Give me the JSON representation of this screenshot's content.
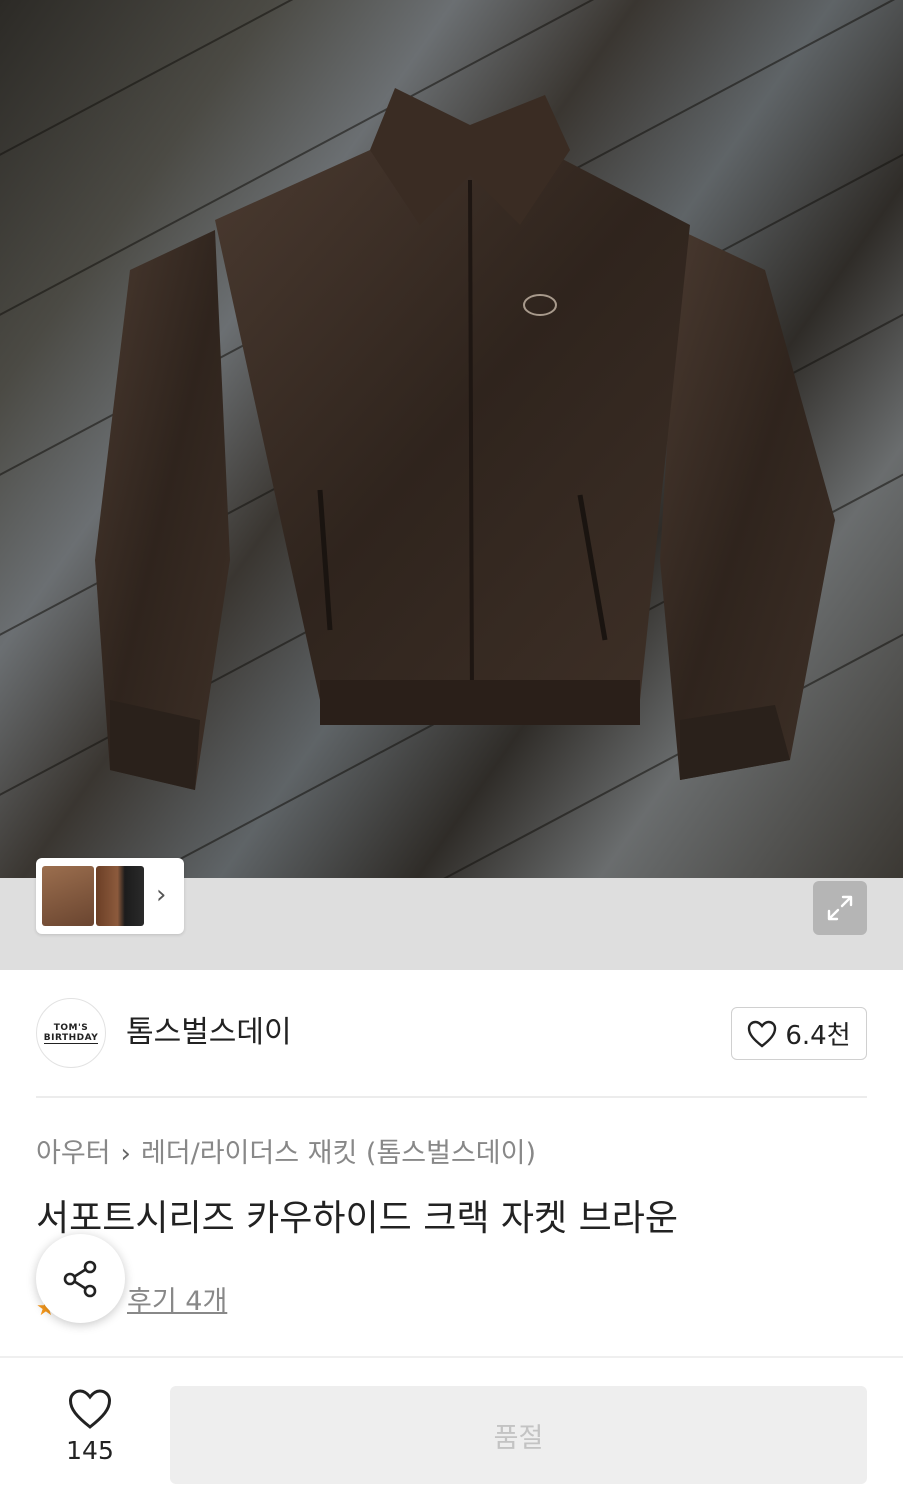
{
  "brand": {
    "logo_line1": "TOM'S",
    "logo_line2": "BIRTHDAY",
    "name": "톰스벌스데이",
    "like_count": "6.4천"
  },
  "breadcrumb": {
    "category": "아우터",
    "subcategory": "레더/라이더스 재킷 (톰스벌스데이)"
  },
  "product": {
    "title": "서포트시리즈 카우하이드 크랙 자켓 브라운",
    "review_text": "후기 4개"
  },
  "gallery": {
    "icons": [
      "chevron-right-icon",
      "expand-icon"
    ]
  },
  "bottom_bar": {
    "wish_count": "145",
    "buy_label": "품절"
  },
  "colors": {
    "accent_star": "#f89a1c",
    "soldout_bg": "#eeeeee",
    "soldout_text": "#c3c3c3"
  }
}
